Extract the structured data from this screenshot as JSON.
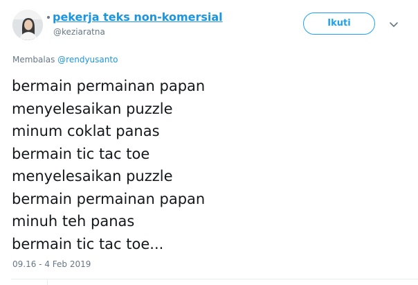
{
  "author": {
    "display_name": "pekerja teks non-komersial",
    "handle": "@keziaratna"
  },
  "follow_button": {
    "label": "Ikuti"
  },
  "reply_context": {
    "prefix": "Membalas",
    "mention": "@rendyusanto"
  },
  "tweet": {
    "lines": [
      "bermain permainan papan",
      "menyelesaikan puzzle",
      "minum coklat panas",
      "bermain tic tac toe",
      "menyelesaikan puzzle",
      "bermain permainan papan",
      "minuh teh panas",
      "bermain tic tac toe..."
    ],
    "timestamp": "09.16 - 4 Feb 2019"
  },
  "icons": {
    "avatar": "profile-photo",
    "chevron": "chevron-down-icon"
  },
  "colors": {
    "link": "#1b95e0",
    "accent": "#1da1f2",
    "secondary_text": "#657786",
    "text": "#14171a",
    "divider": "#e6ecf0"
  }
}
